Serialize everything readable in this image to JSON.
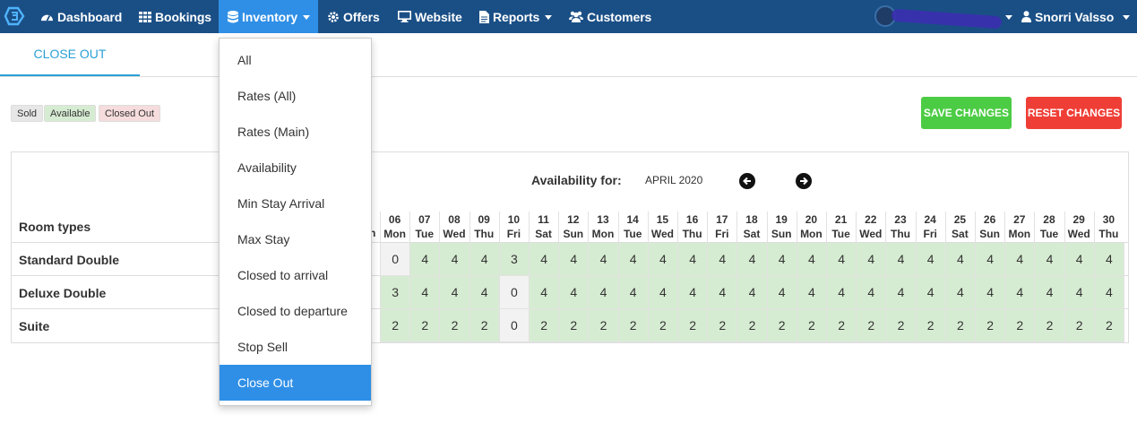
{
  "nav": {
    "items": [
      {
        "label": "Dashboard",
        "icon": "dashboard-icon"
      },
      {
        "label": "Bookings",
        "icon": "grid-icon"
      },
      {
        "label": "Inventory",
        "icon": "database-icon"
      },
      {
        "label": "Offers",
        "icon": "gear-icon"
      },
      {
        "label": "Website",
        "icon": "monitor-icon"
      },
      {
        "label": "Reports",
        "icon": "file-icon"
      },
      {
        "label": "Customers",
        "icon": "users-icon"
      }
    ],
    "user_name": "Snorri Valsso",
    "colors": {
      "bar": "#1a4f86",
      "active": "#2f8fe6"
    }
  },
  "tabs": {
    "active": "CLOSE OUT"
  },
  "legend": {
    "sold": "Sold",
    "available": "Available",
    "closed_out": "Closed Out"
  },
  "buttons": {
    "save": "SAVE CHANGES",
    "reset": "RESET CHANGES"
  },
  "grid": {
    "availability_for": "Availability for:",
    "month": "APRIL 2020",
    "room_types_header": "Room types",
    "days": [
      {
        "num": "06",
        "wd": "Mon"
      },
      {
        "num": "07",
        "wd": "Tue"
      },
      {
        "num": "08",
        "wd": "Wed"
      },
      {
        "num": "09",
        "wd": "Thu"
      },
      {
        "num": "10",
        "wd": "Fri"
      },
      {
        "num": "11",
        "wd": "Sat"
      },
      {
        "num": "12",
        "wd": "Sun"
      },
      {
        "num": "13",
        "wd": "Mon"
      },
      {
        "num": "14",
        "wd": "Tue"
      },
      {
        "num": "15",
        "wd": "Wed"
      },
      {
        "num": "16",
        "wd": "Thu"
      },
      {
        "num": "17",
        "wd": "Fri"
      },
      {
        "num": "18",
        "wd": "Sat"
      },
      {
        "num": "19",
        "wd": "Sun"
      },
      {
        "num": "20",
        "wd": "Mon"
      },
      {
        "num": "21",
        "wd": "Tue"
      },
      {
        "num": "22",
        "wd": "Wed"
      },
      {
        "num": "23",
        "wd": "Thu"
      },
      {
        "num": "24",
        "wd": "Fri"
      },
      {
        "num": "25",
        "wd": "Sat"
      },
      {
        "num": "26",
        "wd": "Sun"
      },
      {
        "num": "27",
        "wd": "Mon"
      },
      {
        "num": "28",
        "wd": "Tue"
      },
      {
        "num": "29",
        "wd": "Wed"
      },
      {
        "num": "30",
        "wd": "Thu"
      }
    ],
    "rooms": [
      {
        "name": "Standard Double",
        "values": [
          "0",
          "4",
          "4",
          "4",
          "3",
          "4",
          "4",
          "4",
          "4",
          "4",
          "4",
          "4",
          "4",
          "4",
          "4",
          "4",
          "4",
          "4",
          "4",
          "4",
          "4",
          "4",
          "4",
          "4",
          "4"
        ]
      },
      {
        "name": "Deluxe Double",
        "values": [
          "3",
          "4",
          "4",
          "4",
          "0",
          "4",
          "4",
          "4",
          "4",
          "4",
          "4",
          "4",
          "4",
          "4",
          "4",
          "4",
          "4",
          "4",
          "4",
          "4",
          "4",
          "4",
          "4",
          "4",
          "4"
        ]
      },
      {
        "name": "Suite",
        "values": [
          "2",
          "2",
          "2",
          "2",
          "0",
          "2",
          "2",
          "2",
          "2",
          "2",
          "2",
          "2",
          "2",
          "2",
          "2",
          "2",
          "2",
          "2",
          "2",
          "2",
          "2",
          "2",
          "2",
          "2",
          "2"
        ]
      }
    ],
    "colors": {
      "available": "#d6ecd2",
      "sold": "#f2f2f2",
      "closed_out": "#f6dcdc"
    }
  },
  "dropdown": {
    "items": [
      "All",
      "Rates (All)",
      "Rates (Main)",
      "Availability",
      "Min Stay Arrival",
      "Max Stay",
      "Closed to arrival",
      "Closed to departure",
      "Stop Sell",
      "Close Out"
    ],
    "active": "Close Out"
  }
}
